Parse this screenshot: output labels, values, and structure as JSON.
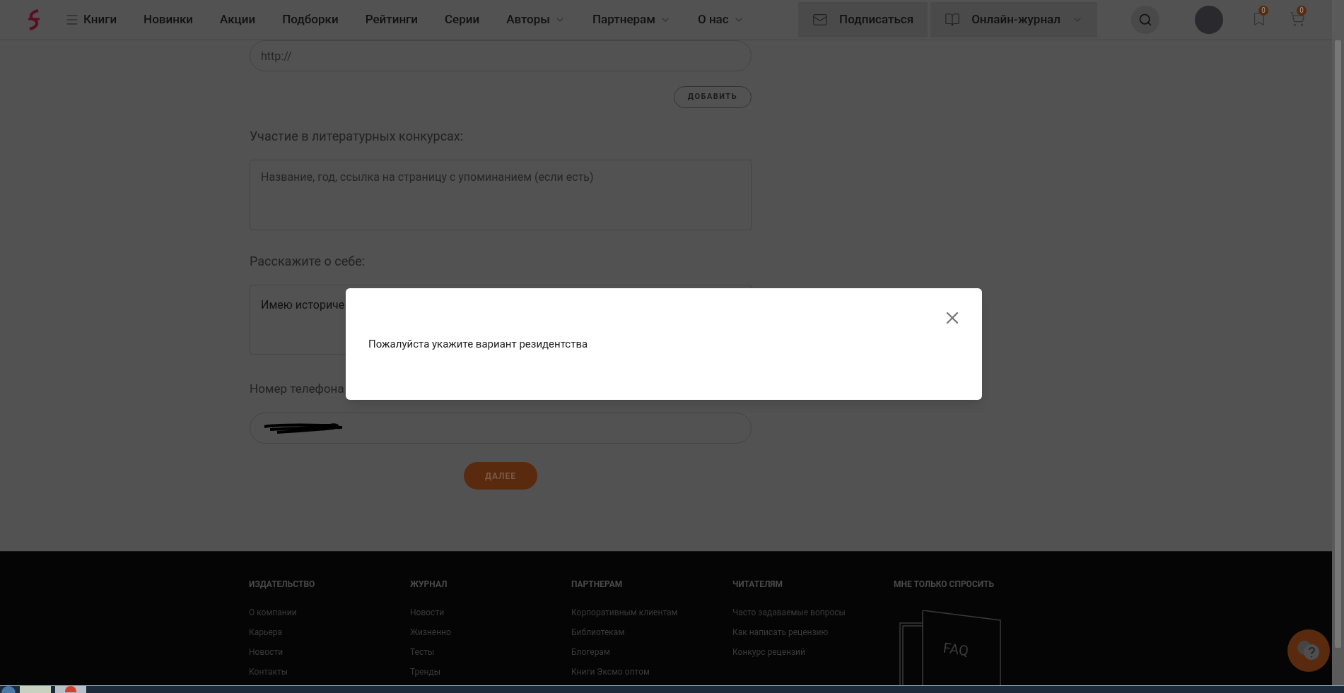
{
  "header": {
    "nav": [
      {
        "label": "Книги",
        "menu_icon": true,
        "dropdown": false
      },
      {
        "label": "Новинки",
        "menu_icon": false,
        "dropdown": false
      },
      {
        "label": "Акции",
        "menu_icon": false,
        "dropdown": false
      },
      {
        "label": "Подборки",
        "menu_icon": false,
        "dropdown": false
      },
      {
        "label": "Рейтинги",
        "menu_icon": false,
        "dropdown": false
      },
      {
        "label": "Серии",
        "menu_icon": false,
        "dropdown": false
      },
      {
        "label": "Авторы",
        "menu_icon": false,
        "dropdown": true
      },
      {
        "label": "Партнерам",
        "menu_icon": false,
        "dropdown": true
      },
      {
        "label": "О нас",
        "menu_icon": false,
        "dropdown": true
      }
    ],
    "subscribe": "Подписаться",
    "journal": "Онлайн-журнал",
    "bookmarks_count": "0",
    "cart_count": "0"
  },
  "form": {
    "url_field": {
      "placeholder": "http://"
    },
    "add_button": "ДОБАВИТЬ",
    "contests": {
      "label": "Участие в литературных конкурсах:",
      "placeholder": "Название, год, ссылка на страницу с упоминанием (если есть)"
    },
    "about": {
      "label": "Расскажите о себе:",
      "value": "Имею историче"
    },
    "phone": {
      "label": "Номер телефона"
    },
    "next_button": "ДАЛЕЕ"
  },
  "modal": {
    "message": "Пожалуйста укажите вариант резидентства"
  },
  "footer": {
    "columns": [
      {
        "title": "ИЗДАТЕЛЬСТВО",
        "links": [
          "О компании",
          "Карьера",
          "Новости",
          "Контакты"
        ]
      },
      {
        "title": "ЖУРНАЛ",
        "links": [
          "Новости",
          "Жизненно",
          "Тесты",
          "Тренды"
        ]
      },
      {
        "title": "ПАРТНЕРАМ",
        "links": [
          "Корпоративным клиентам",
          "Библиотекам",
          "Блогерам",
          "Книги Эксмо оптом"
        ]
      },
      {
        "title": "ЧИТАТЕЛЯМ",
        "links": [
          "Часто задаваемые вопросы",
          "Как написать рецензию",
          "Конкурс рецензий"
        ]
      }
    ],
    "ask": {
      "title": "МНЕ ТОЛЬКО СПРОСИТЬ",
      "faq_label": "FAQ"
    }
  }
}
